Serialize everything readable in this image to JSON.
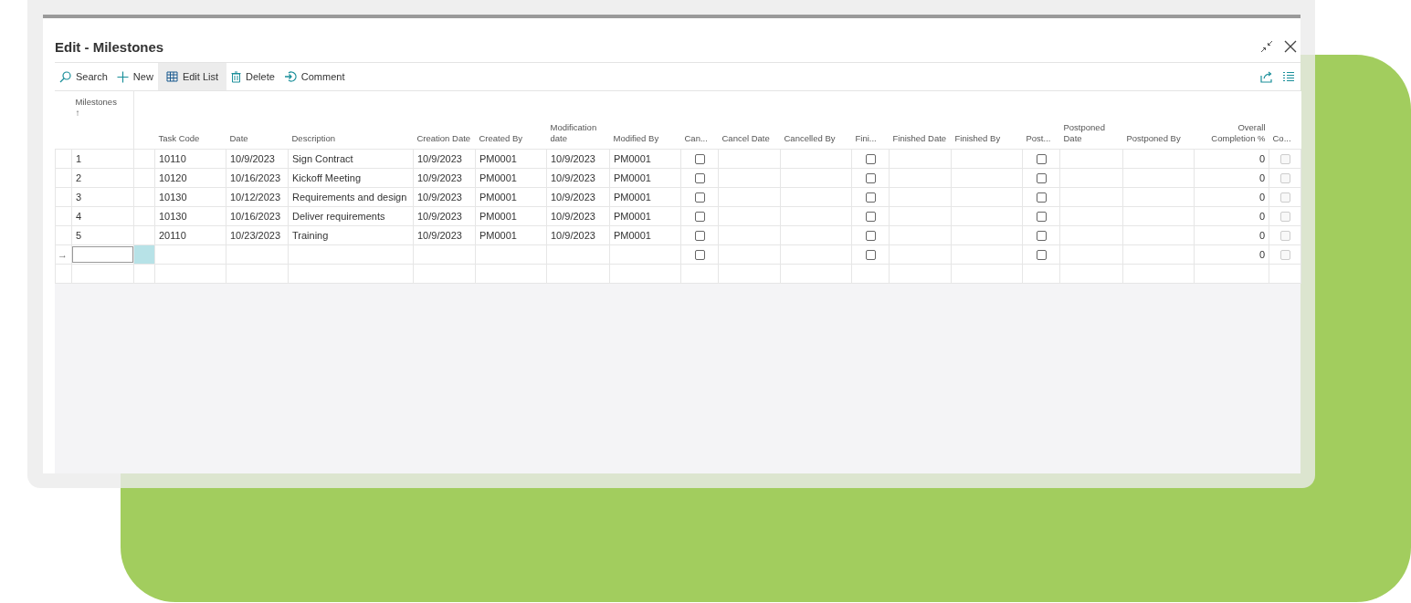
{
  "dialog": {
    "title": "Edit - Milestones"
  },
  "toolbar": {
    "actions": [
      {
        "label": "Search",
        "selected": false
      },
      {
        "label": "New",
        "selected": false
      },
      {
        "label": "Edit List",
        "selected": true
      },
      {
        "label": "Delete",
        "selected": false
      },
      {
        "label": "Comment",
        "selected": false
      }
    ]
  },
  "table": {
    "columns": [
      {
        "kind": "indicator"
      },
      {
        "label": "Milestones",
        "sort_arrow": "↑",
        "kind": "text"
      },
      {
        "kind": "spacer"
      },
      {
        "label": "Task Code",
        "kind": "text"
      },
      {
        "label": "Date",
        "kind": "text"
      },
      {
        "label": "Description",
        "kind": "text"
      },
      {
        "label": "Creation Date",
        "kind": "text"
      },
      {
        "label": "Created By",
        "kind": "text"
      },
      {
        "label": "Modification date",
        "kind": "text"
      },
      {
        "label": "Modified By",
        "kind": "text"
      },
      {
        "label": "Can...",
        "kind": "check"
      },
      {
        "label": "Cancel Date",
        "kind": "text"
      },
      {
        "label": "Cancelled By",
        "kind": "text"
      },
      {
        "label": "Fini...",
        "kind": "check"
      },
      {
        "label": "Finished Date",
        "kind": "text"
      },
      {
        "label": "Finished By",
        "kind": "text"
      },
      {
        "label": "Post...",
        "kind": "check"
      },
      {
        "label": "Postponed Date",
        "kind": "text"
      },
      {
        "label": "Postponed By",
        "kind": "text"
      },
      {
        "label": "Overall Completion %",
        "kind": "number"
      },
      {
        "label": "Co...",
        "kind": "check"
      }
    ],
    "rows": [
      {
        "kind": "data",
        "selected": false,
        "cells": [
          null,
          "1",
          null,
          "10110",
          "10/9/2023",
          "Sign Contract",
          "10/9/2023",
          "PM0001",
          "10/9/2023",
          "PM0001",
          {
            "checked": false,
            "disabled": false
          },
          null,
          null,
          {
            "checked": false,
            "disabled": false
          },
          null,
          null,
          {
            "checked": false,
            "disabled": false
          },
          null,
          null,
          "0",
          {
            "checked": false,
            "disabled": true
          }
        ]
      },
      {
        "kind": "data",
        "selected": false,
        "cells": [
          null,
          "2",
          null,
          "10120",
          "10/16/2023",
          "Kickoff Meeting",
          "10/9/2023",
          "PM0001",
          "10/9/2023",
          "PM0001",
          {
            "checked": false,
            "disabled": false
          },
          null,
          null,
          {
            "checked": false,
            "disabled": false
          },
          null,
          null,
          {
            "checked": false,
            "disabled": false
          },
          null,
          null,
          "0",
          {
            "checked": false,
            "disabled": true
          }
        ]
      },
      {
        "kind": "data",
        "selected": false,
        "cells": [
          null,
          "3",
          null,
          "10130",
          "10/12/2023",
          "Requirements and design",
          "10/9/2023",
          "PM0001",
          "10/9/2023",
          "PM0001",
          {
            "checked": false,
            "disabled": false
          },
          null,
          null,
          {
            "checked": false,
            "disabled": false
          },
          null,
          null,
          {
            "checked": false,
            "disabled": false
          },
          null,
          null,
          "0",
          {
            "checked": false,
            "disabled": true
          }
        ]
      },
      {
        "kind": "data",
        "selected": false,
        "cells": [
          null,
          "4",
          null,
          "10130",
          "10/16/2023",
          "Deliver requirements",
          "10/9/2023",
          "PM0001",
          "10/9/2023",
          "PM0001",
          {
            "checked": false,
            "disabled": false
          },
          null,
          null,
          {
            "checked": false,
            "disabled": false
          },
          null,
          null,
          {
            "checked": false,
            "disabled": false
          },
          null,
          null,
          "0",
          {
            "checked": false,
            "disabled": true
          }
        ]
      },
      {
        "kind": "data",
        "selected": false,
        "cells": [
          null,
          "5",
          null,
          "20110",
          "10/23/2023",
          "Training",
          "10/9/2023",
          "PM0001",
          "10/9/2023",
          "PM0001",
          {
            "checked": false,
            "disabled": false
          },
          null,
          null,
          {
            "checked": false,
            "disabled": false
          },
          null,
          null,
          {
            "checked": false,
            "disabled": false
          },
          null,
          null,
          "0",
          {
            "checked": false,
            "disabled": true
          }
        ]
      },
      {
        "kind": "data",
        "selected": true,
        "cells": [
          "→",
          null,
          null,
          null,
          null,
          null,
          null,
          null,
          null,
          null,
          {
            "checked": false,
            "disabled": false
          },
          null,
          null,
          {
            "checked": false,
            "disabled": false
          },
          null,
          null,
          {
            "checked": false,
            "disabled": false
          },
          null,
          null,
          "0",
          {
            "checked": false,
            "disabled": true
          }
        ]
      },
      {
        "kind": "blank",
        "selected": false
      }
    ]
  }
}
